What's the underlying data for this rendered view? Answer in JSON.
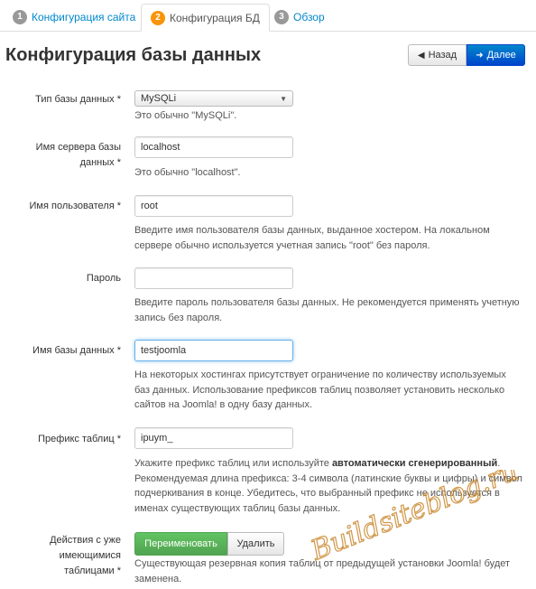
{
  "tabs": [
    {
      "number": "1",
      "label": "Конфигурация сайта"
    },
    {
      "number": "2",
      "label": "Конфигурация БД"
    },
    {
      "number": "3",
      "label": "Обзор"
    }
  ],
  "header": {
    "title": "Конфигурация базы данных",
    "back_label": "Назад",
    "next_label": "Далее"
  },
  "form": {
    "db_type": {
      "label": "Тип базы данных *",
      "value": "MySQLi",
      "help": "Это обычно \"MySQLi\"."
    },
    "host": {
      "label_line1": "Имя сервера базы",
      "label_line2": "данных *",
      "value": "localhost",
      "help": "Это обычно \"localhost\"."
    },
    "user": {
      "label": "Имя пользователя *",
      "value": "root",
      "help_line1": "Введите имя пользователя базы данных, выданное хостером. На локальном",
      "help_line2": "сервере обычно используется учетная запись \"root\" без пароля."
    },
    "password": {
      "label": "Пароль",
      "value": "",
      "help_line1": "Введите пароль пользователя базы данных. Не рекомендуется применять учетную",
      "help_line2": "запись без пароля."
    },
    "db_name": {
      "label": "Имя базы данных *",
      "value": "testjoomla",
      "help_line1": "На некоторых хостингах присутствует ограничение по количеству используемых",
      "help_line2": "баз данных. Использование префиксов таблиц позволяет установить несколько",
      "help_line3": "сайтов на Joomla! в одну базу данных."
    },
    "prefix": {
      "label": "Префикс таблиц *",
      "value": "ipuym_",
      "help_line1_a": "Укажите префикс таблиц или используйте ",
      "help_line1_b": "автоматически сгенерированный",
      "help_line1_c": ".",
      "help_line2": "Рекомендуемая длина префикса: 3-4 символа (латинские буквы и цифры) и символ",
      "help_line3": "подчеркивания в конце. Убедитесь, что выбранный префикс не используется в",
      "help_line4": "именах существующих таблиц базы данных."
    },
    "old_tables": {
      "label_line1": "Действия с уже",
      "label_line2": "имеющимися",
      "label_line3": "таблицами *",
      "rename_label": "Переименовать",
      "delete_label": "Удалить",
      "help_line1": "Существующая резервная копия таблиц от предыдущей установки Joomla! будет",
      "help_line2": "заменена."
    }
  },
  "watermark": {
    "text": "Buildsiteblog.ru",
    "color": "#c8862a"
  },
  "colors": {
    "link": "#0088cc",
    "primary": "#0044cc",
    "success": "#51a351",
    "badge_active": "#f89406"
  }
}
